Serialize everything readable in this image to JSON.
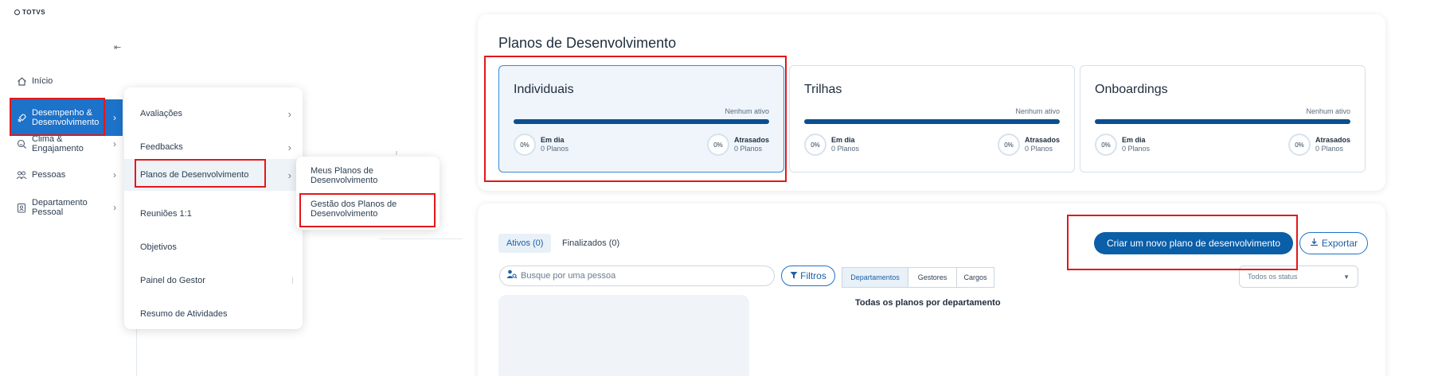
{
  "brand": {
    "name": "TOTVS"
  },
  "sidebar": {
    "collapse_icon": "collapse-left-icon",
    "items": [
      {
        "label": "Início",
        "icon": "home-icon"
      },
      {
        "label": "Desempenho & Desenvolvimento",
        "icon": "rocket-icon"
      },
      {
        "label": "Clima & Engajamento",
        "icon": "search-smile-icon"
      },
      {
        "label": "Pessoas",
        "icon": "people-icon"
      },
      {
        "label": "Departamento Pessoal",
        "icon": "badge-icon"
      }
    ]
  },
  "submenu": {
    "items": [
      {
        "label": "Avaliações"
      },
      {
        "label": "Feedbacks"
      },
      {
        "label": "Planos de Desenvolvimento"
      },
      {
        "label": "Reuniões 1:1"
      },
      {
        "label": "Objetivos"
      },
      {
        "label": "Painel do Gestor"
      },
      {
        "label": "Resumo de Atividades"
      }
    ]
  },
  "submenu2": {
    "items": [
      {
        "label": "Meus Planos de Desenvolvimento"
      },
      {
        "label": "Gestão dos Planos de Desenvolvimento"
      }
    ]
  },
  "page": {
    "title": "Planos de Desenvolvimento",
    "cards": [
      {
        "title": "Individuais",
        "status": "Nenhum ativo",
        "on_time": {
          "pct": "0%",
          "label": "Em dia",
          "sub": "0 Planos"
        },
        "late": {
          "pct": "0%",
          "label": "Atrasados",
          "sub": "0 Planos"
        }
      },
      {
        "title": "Trilhas",
        "status": "Nenhum ativo",
        "on_time": {
          "pct": "0%",
          "label": "Em dia",
          "sub": "0 Planos"
        },
        "late": {
          "pct": "0%",
          "label": "Atrasados",
          "sub": "0 Planos"
        }
      },
      {
        "title": "Onboardings",
        "status": "Nenhum ativo",
        "on_time": {
          "pct": "0%",
          "label": "Em dia",
          "sub": "0 Planos"
        },
        "late": {
          "pct": "0%",
          "label": "Atrasados",
          "sub": "0 Planos"
        }
      }
    ]
  },
  "list": {
    "tabs": [
      {
        "label": "Ativos (0)"
      },
      {
        "label": "Finalizados (0)"
      }
    ],
    "create_button": "Criar um novo plano de desenvolvimento",
    "export_button": "Exportar",
    "search_placeholder": "Busque por uma pessoa",
    "filter_button": "Filtros",
    "segments": [
      {
        "label": "Departamentos"
      },
      {
        "label": "Gestores"
      },
      {
        "label": "Cargos"
      }
    ],
    "status_select": "Todos os status",
    "chart_heading": "Todas os planos por departamento"
  },
  "colors": {
    "primary": "#0b5ea8",
    "active_nav": "#1d72c9",
    "highlight": "#e2181b"
  }
}
